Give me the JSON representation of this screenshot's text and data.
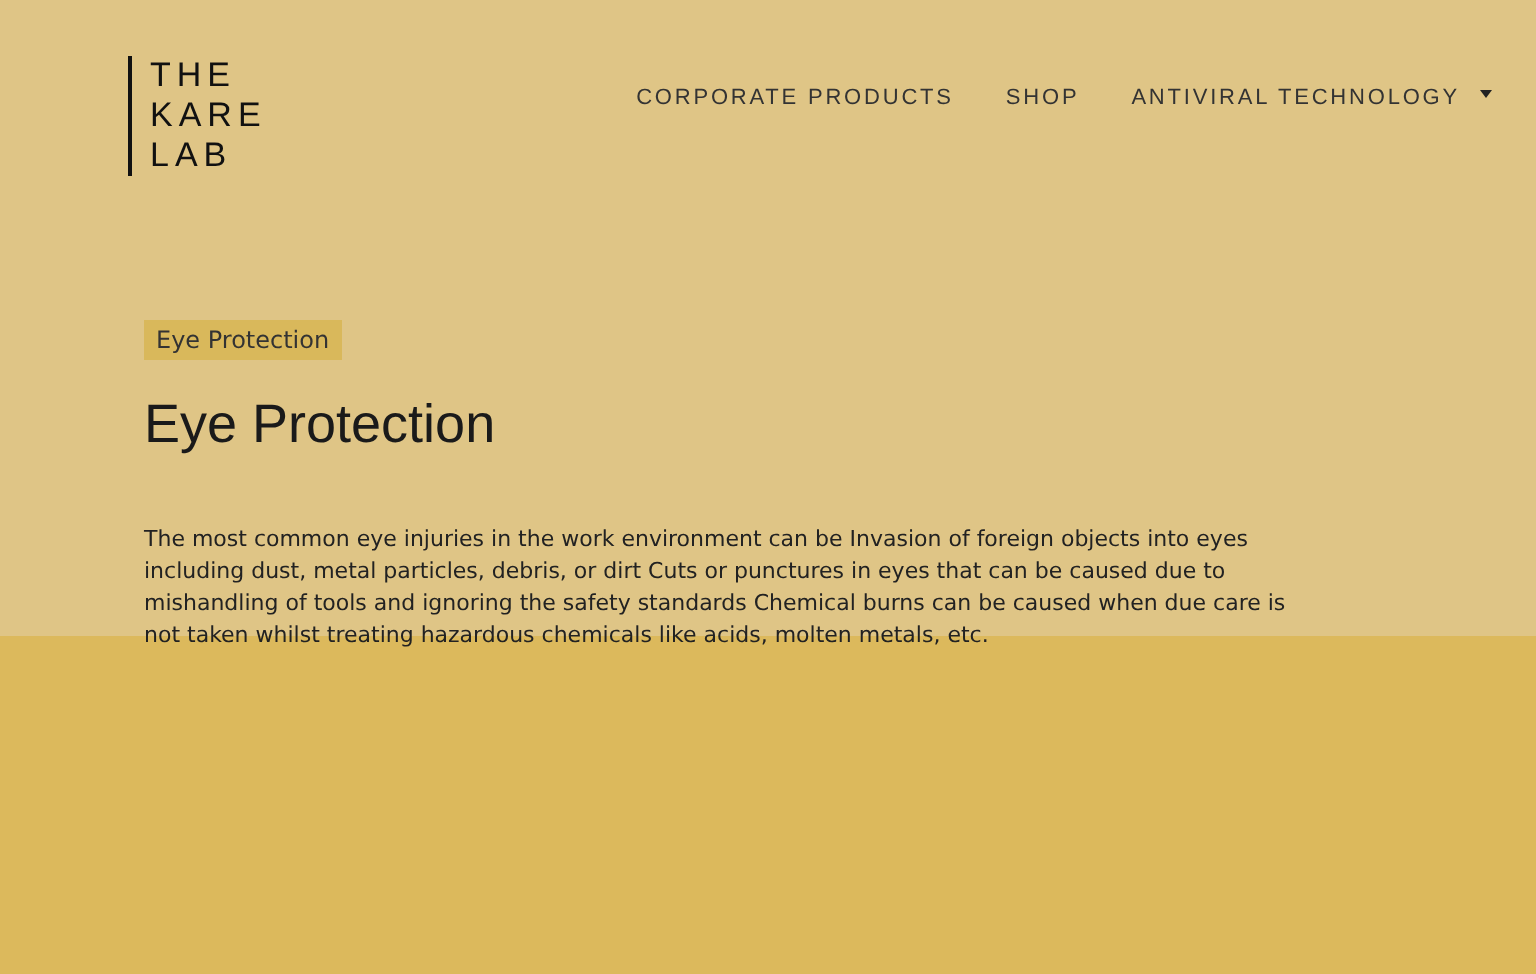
{
  "logo": {
    "lines": [
      "THE",
      "KARE",
      "LAB"
    ]
  },
  "nav": [
    {
      "label": "CORPORATE PRODUCTS",
      "dropdown": false
    },
    {
      "label": "SHOP",
      "dropdown": false
    },
    {
      "label": "ANTIVIRAL TECHNOLOGY",
      "dropdown": true
    }
  ],
  "tag": "Eye Protection",
  "heading": "Eye Protection",
  "body": "The most common eye injuries in the work environment can be Invasion of foreign objects into eyes including dust, metal particles, debris, or dirt Cuts or punctures in eyes that can be caused due to mishandling of tools and ignoring the safety standards Chemical burns can be caused when due care is not taken whilst treating hazardous chemicals like acids, molten metals, etc."
}
